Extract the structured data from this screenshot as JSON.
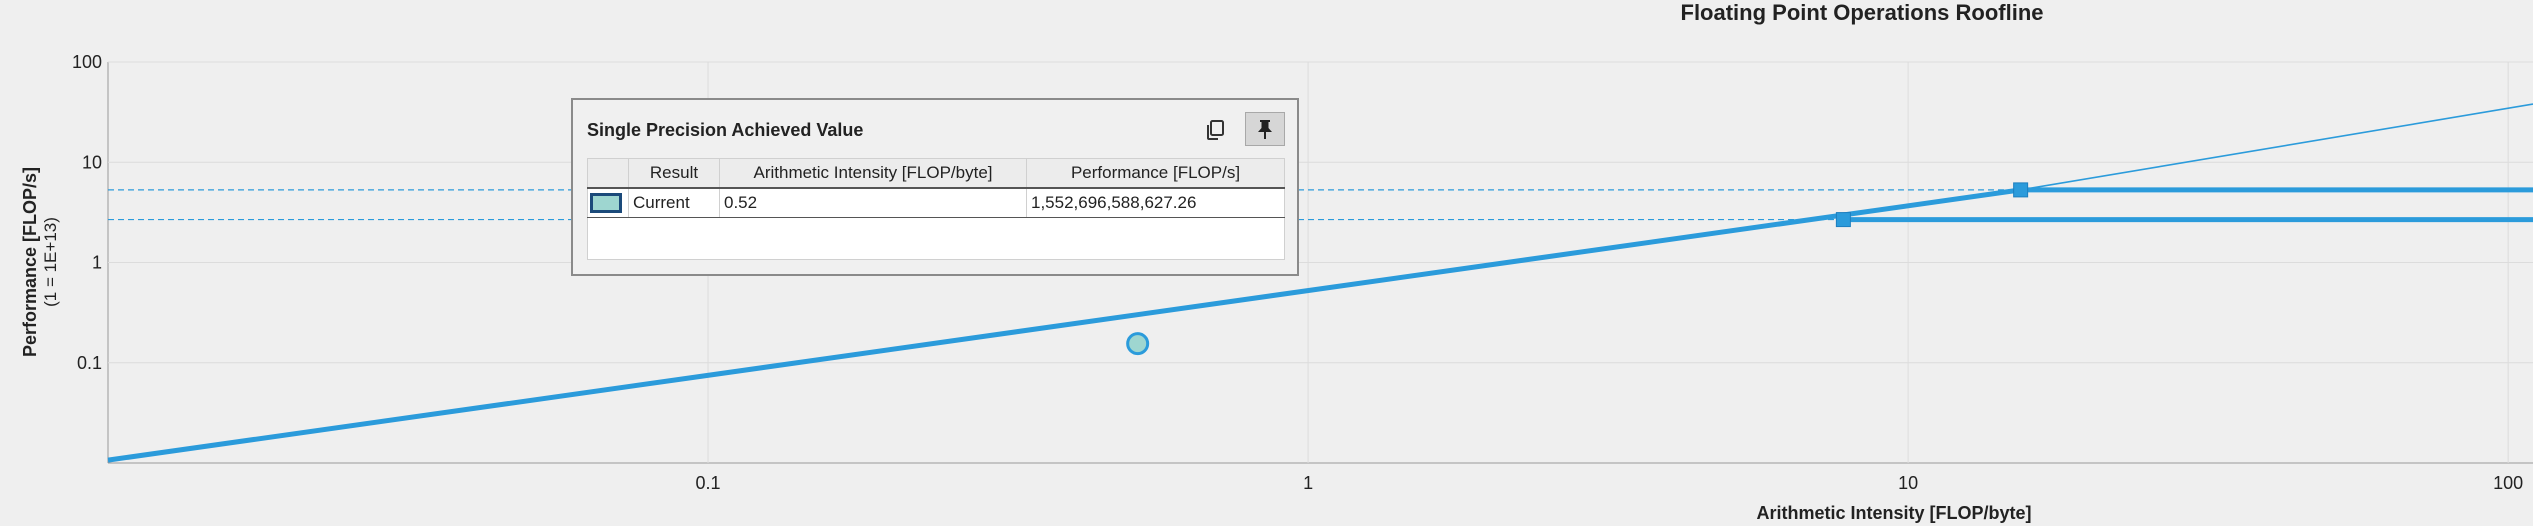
{
  "chart_data": {
    "type": "line",
    "title": "Floating Point Operations Roofline",
    "xlabel": "Arithmetic Intensity [FLOP/byte]",
    "ylabel": "Performance [FLOP/s]",
    "ylabel_unit": "(1 = 1E+13)",
    "x_scale": "log",
    "y_scale": "log",
    "xlim": [
      0.01,
      110
    ],
    "ylim": [
      0.01,
      100
    ],
    "x_ticks": [
      {
        "value": 0.1,
        "label": "0.1"
      },
      {
        "value": 1,
        "label": "1"
      },
      {
        "value": 10,
        "label": "10"
      },
      {
        "value": 100,
        "label": "100"
      }
    ],
    "y_ticks": [
      {
        "value": 0.1,
        "label": "0.1"
      },
      {
        "value": 1,
        "label": "1"
      },
      {
        "value": 10,
        "label": "10"
      },
      {
        "value": 100,
        "label": "100"
      }
    ],
    "grid": true,
    "series": [
      {
        "points": [
          [
            0.01,
            0.0107
          ],
          [
            15.4,
            5.3
          ],
          [
            110,
            5.3
          ]
        ],
        "style": "roof-thick"
      },
      {
        "points": [
          [
            7.8,
            2.68
          ],
          [
            110,
            2.68
          ]
        ],
        "style": "roof-thick"
      },
      {
        "points": [
          [
            15.4,
            5.3
          ],
          [
            110,
            38
          ]
        ],
        "style": "thin"
      }
    ],
    "guide_lines": [
      5.3,
      2.68
    ],
    "ridge_points": [
      {
        "x": 7.8,
        "y": 2.68
      },
      {
        "x": 15.4,
        "y": 5.3
      }
    ],
    "achieved_point": {
      "x": 0.52,
      "y": 0.155
    },
    "line_color": "#2b9bdb",
    "marker_fill": "#9ed6d0"
  },
  "tooltip": {
    "title": "Single Precision Achieved Value",
    "columns": [
      "Result",
      "Arithmetic Intensity [FLOP/byte]",
      "Performance [FLOP/s]"
    ],
    "rows": [
      {
        "result": "Current",
        "intensity": "0.52",
        "performance": "1,552,696,588,627.26"
      }
    ]
  }
}
